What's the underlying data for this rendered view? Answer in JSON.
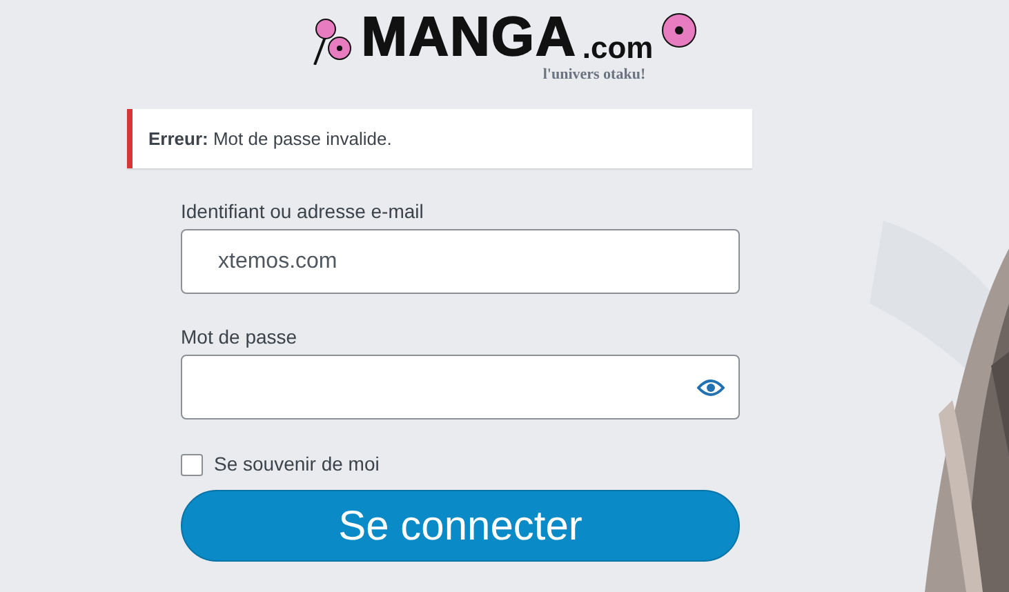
{
  "logo": {
    "name": "MANGA",
    "suffix": ".com",
    "tagline": "l'univers otaku!"
  },
  "notice": {
    "label": "Erreur:",
    "message": "Mot de passe invalide."
  },
  "form": {
    "username": {
      "label": "Identifiant ou adresse e-mail",
      "value": "xtemos.com"
    },
    "password": {
      "label": "Mot de passe"
    },
    "remember": {
      "label": "Se souvenir de moi",
      "checked": false
    },
    "submit": "Se connecter"
  }
}
